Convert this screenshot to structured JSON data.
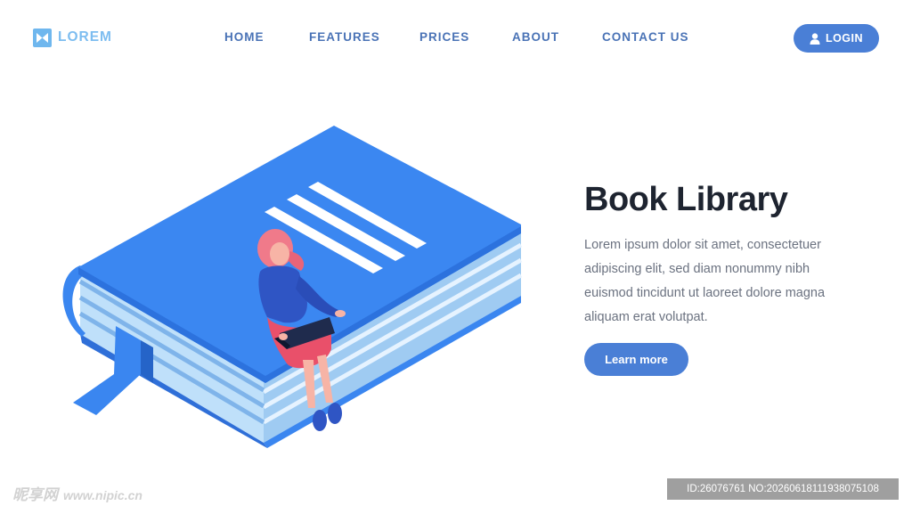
{
  "brand": {
    "name": "LOREM",
    "icon": "bowtie-logo-icon"
  },
  "nav": {
    "items": [
      {
        "label": "HOME"
      },
      {
        "label": "FEATURES"
      },
      {
        "label": "PRICES"
      },
      {
        "label": "ABOUT"
      },
      {
        "label": "CONTACT US"
      }
    ],
    "login": {
      "label": "LOGIN",
      "icon": "user-icon"
    }
  },
  "hero": {
    "title": "Book Library",
    "description": "Lorem ipsum dolor sit amet, consectetuer adipiscing elit, sed diam nonummy nibh euismod tincidunt ut laoreet dolore magna aliquam erat volutpat.",
    "cta": "Learn more"
  },
  "watermark": {
    "left": "昵享网",
    "left_url": "www.nipic.cn",
    "right": "ID:26076761 NO:20260618111938075108"
  },
  "colors": {
    "primary": "#4a7fd6",
    "nav_text": "#4a73b6",
    "book_blue": "#3a86f0",
    "page_light": "#b9dbf7",
    "figure_hair": "#f07a8a",
    "figure_skirt": "#e9506a"
  }
}
